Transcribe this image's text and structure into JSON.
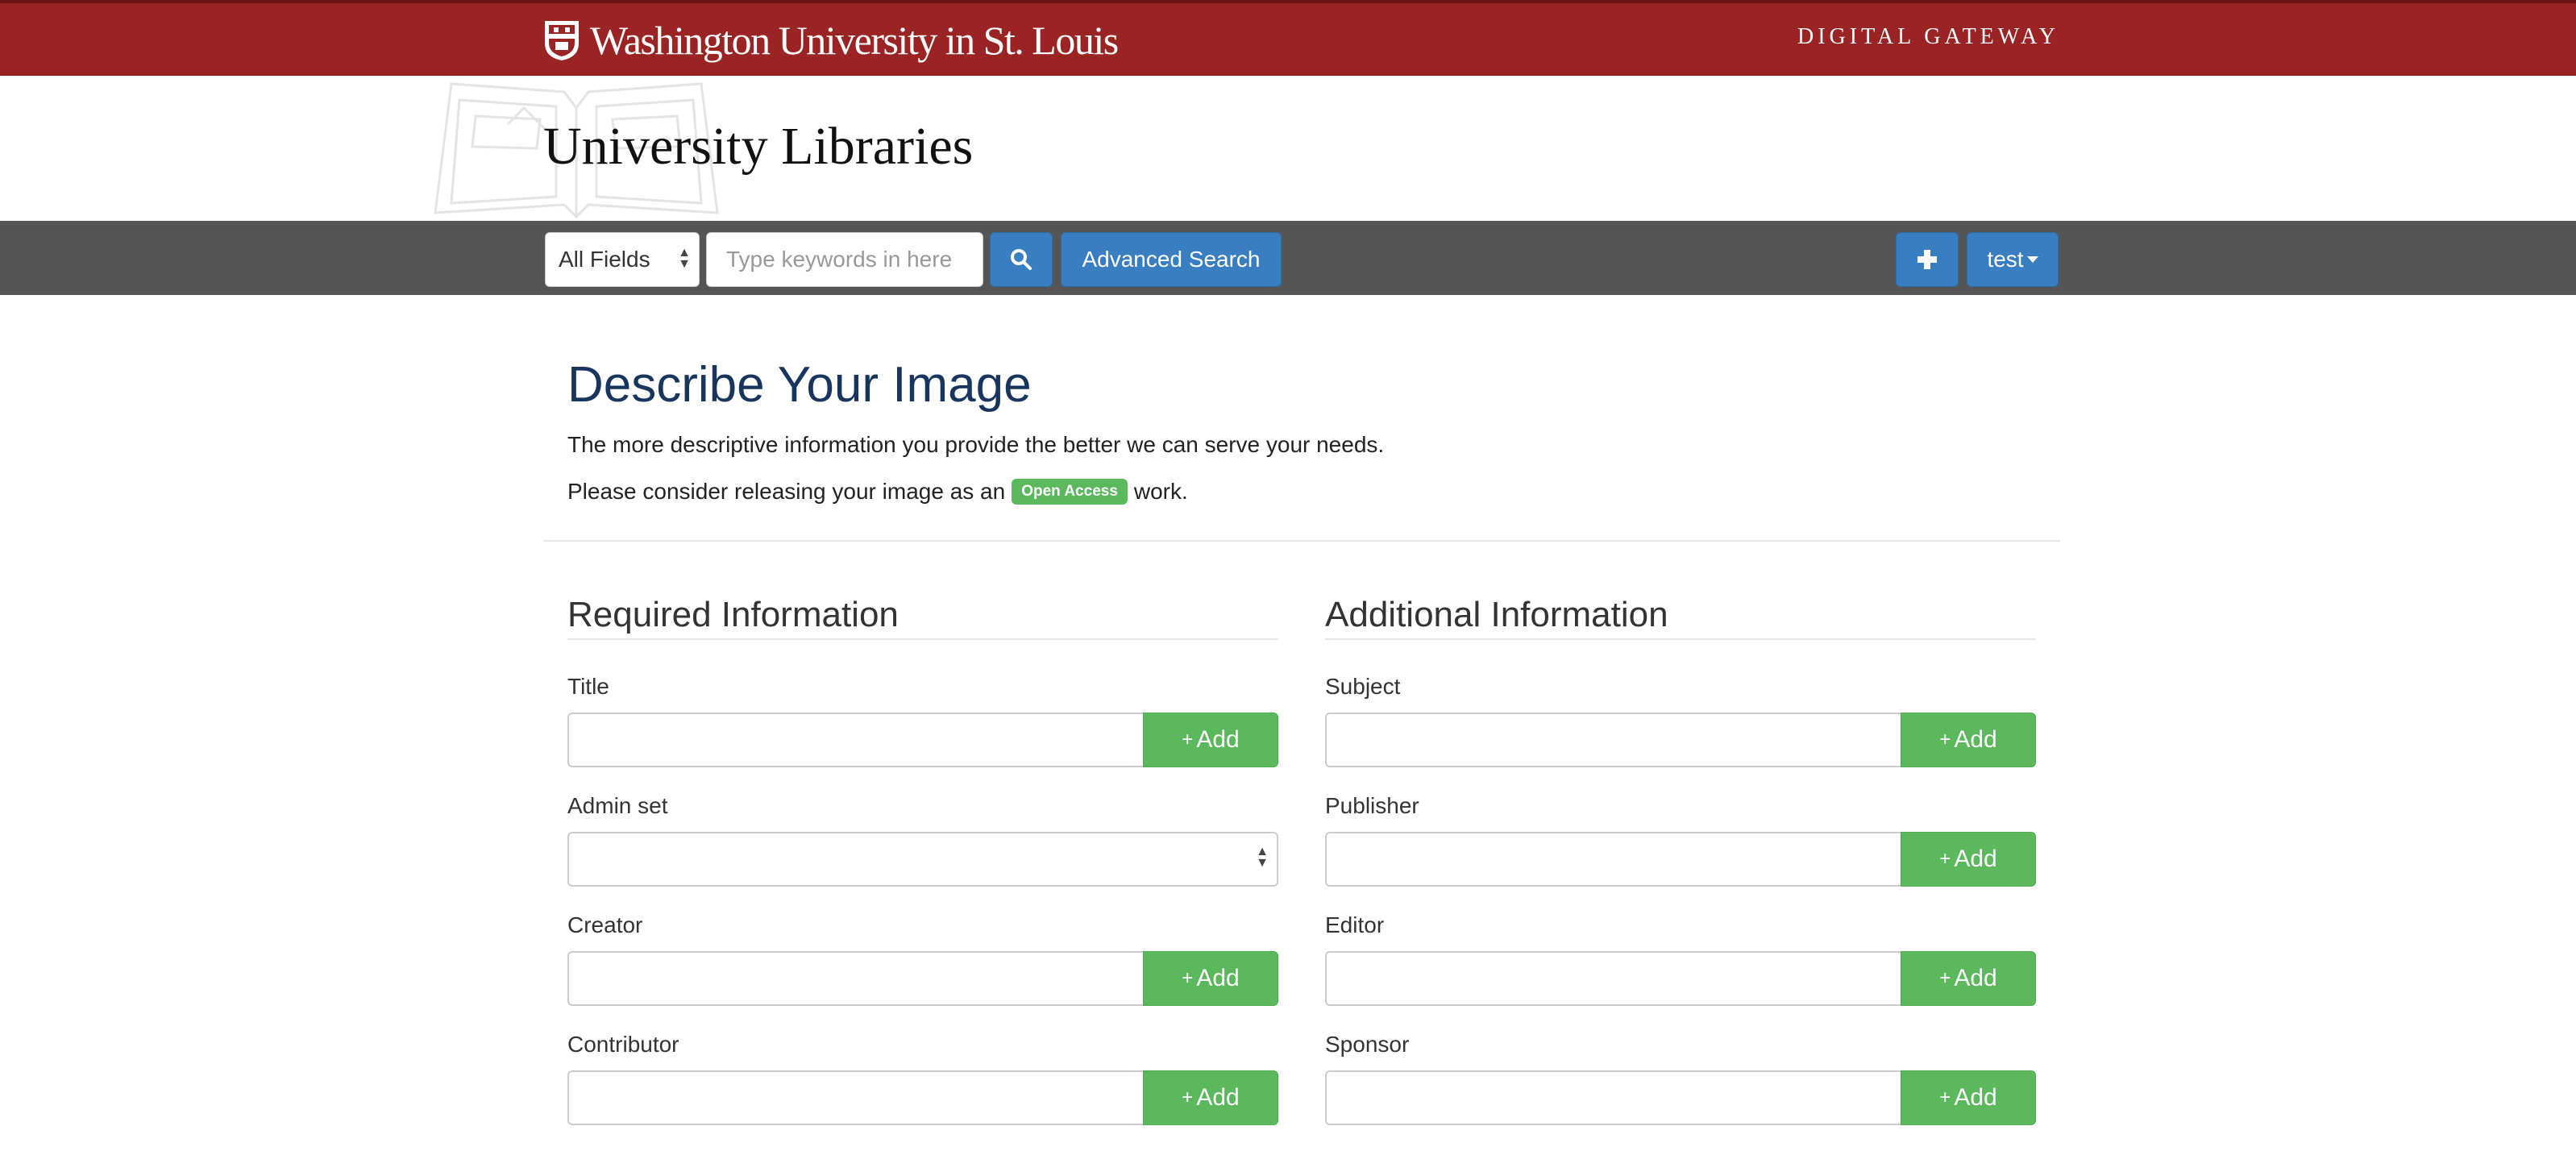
{
  "topbar": {
    "university_name": "Washington University in St. Louis",
    "gateway_label": "DIGITAL GATEWAY",
    "brand_color": "#9a2423"
  },
  "header": {
    "site_title": "University Libraries"
  },
  "searchbar": {
    "field_select_value": "All Fields",
    "search_placeholder": "Type keywords in here",
    "advanced_search_label": "Advanced Search",
    "user_menu_label": "test",
    "icons": [
      "search-icon",
      "plus-icon"
    ]
  },
  "main": {
    "heading": "Describe Your Image",
    "intro_text": "The more descriptive information you provide the better we can serve your needs.",
    "open_access_prefix": "Please consider releasing your image as an",
    "open_access_badge": "Open Access",
    "open_access_suffix": "work."
  },
  "required": {
    "title": "Required Information",
    "fields": [
      {
        "label": "Title",
        "value": "",
        "add_label": "Add"
      },
      {
        "label": "Admin set",
        "value": ""
      },
      {
        "label": "Creator",
        "value": "",
        "add_label": "Add"
      },
      {
        "label": "Contributor",
        "value": "",
        "add_label": "Add"
      }
    ]
  },
  "additional": {
    "title": "Additional Information",
    "fields": [
      {
        "label": "Subject",
        "value": "",
        "add_label": "Add"
      },
      {
        "label": "Publisher",
        "value": "",
        "add_label": "Add"
      },
      {
        "label": "Editor",
        "value": "",
        "add_label": "Add"
      },
      {
        "label": "Sponsor",
        "value": "",
        "add_label": "Add"
      }
    ]
  },
  "colors": {
    "primary_blue": "#3a7ec2",
    "success_green": "#5cb85c",
    "heading_blue": "#18355e",
    "searchbar_gray": "#555555"
  }
}
